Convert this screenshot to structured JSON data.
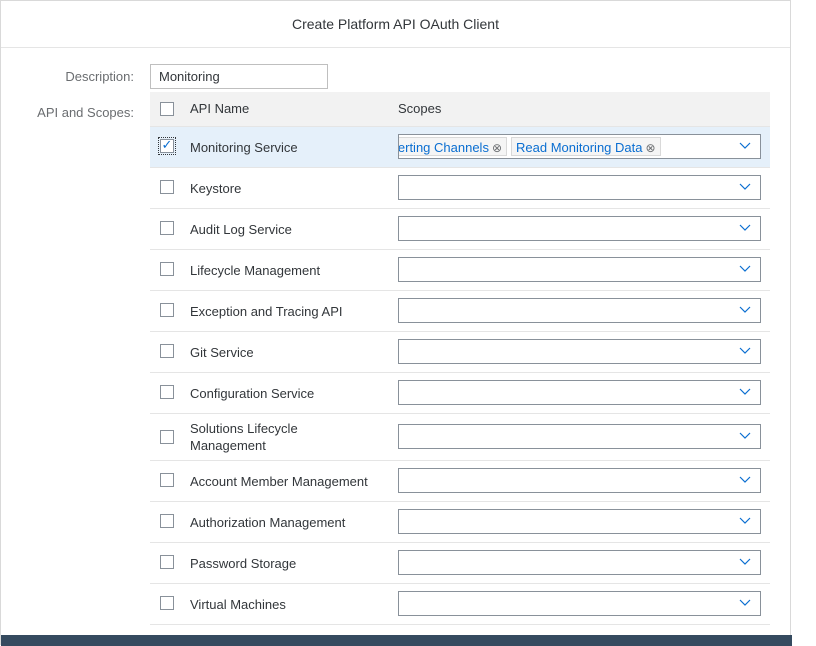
{
  "dialog": {
    "title": "Create Platform API OAuth Client"
  },
  "form": {
    "description_label": "Description:",
    "description_value": "Monitoring",
    "api_scopes_label": "API and Scopes:"
  },
  "table": {
    "columns": {
      "api_name": "API Name",
      "scopes": "Scopes"
    },
    "rows": [
      {
        "api": "Monitoring Service",
        "checked": true,
        "scopes": [
          {
            "label": "lerting Channels",
            "remove": "⊗"
          },
          {
            "label": "Read Monitoring Data",
            "remove": "⊗"
          }
        ]
      },
      {
        "api": "Keystore",
        "checked": false,
        "scopes": []
      },
      {
        "api": "Audit Log Service",
        "checked": false,
        "scopes": []
      },
      {
        "api": "Lifecycle Management",
        "checked": false,
        "scopes": []
      },
      {
        "api": "Exception and Tracing API",
        "checked": false,
        "scopes": []
      },
      {
        "api": "Git Service",
        "checked": false,
        "scopes": []
      },
      {
        "api": "Configuration Service",
        "checked": false,
        "scopes": []
      },
      {
        "api": "Solutions Lifecycle Management",
        "checked": false,
        "scopes": []
      },
      {
        "api": "Account Member Management",
        "checked": false,
        "scopes": []
      },
      {
        "api": "Authorization Management",
        "checked": false,
        "scopes": []
      },
      {
        "api": "Password Storage",
        "checked": false,
        "scopes": []
      },
      {
        "api": "Virtual Machines",
        "checked": false,
        "scopes": []
      }
    ]
  },
  "icons": {
    "checkmark": "✓",
    "dropdown": "chevron-down-icon"
  },
  "colors": {
    "accent": "#0a6ed1",
    "selected_row": "#e5f0fa",
    "header_bg": "#f2f2f2",
    "footer": "#354a5f"
  }
}
